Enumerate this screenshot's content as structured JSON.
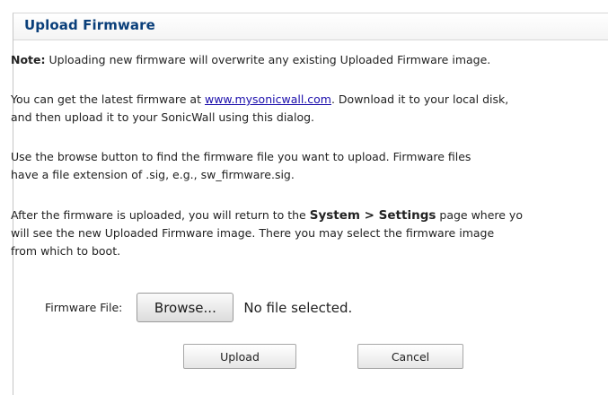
{
  "dialog": {
    "title": "Upload Firmware",
    "note": {
      "label": "Note:",
      "text": " Uploading new firmware will overwrite any existing Uploaded Firmware image."
    },
    "paragraph_latest": {
      "line1_pre": "You can get the latest firmware at ",
      "link_text": "www.mysonicwall.com",
      "line1_post": ". Download it to your local disk,",
      "line2": "and then upload it to your SonicWall using this dialog."
    },
    "paragraph_browse": {
      "line1": "Use the browse button to find the firmware file you want to upload. Firmware files",
      "line2": "have a file extension of .sig, e.g., sw_firmware.sig."
    },
    "paragraph_after": {
      "line1_pre": "After the firmware is uploaded, you will return to the ",
      "line1_strong": "System > Settings",
      "line1_post": " page where yo",
      "line2": "will see the new Uploaded Firmware image. There you may select the firmware image",
      "line3": "from which to boot."
    },
    "file_field": {
      "label": "Firmware File:",
      "browse_label": "Browse...",
      "status": "No file selected."
    },
    "buttons": {
      "upload_label": "Upload",
      "cancel_label": "Cancel"
    }
  }
}
